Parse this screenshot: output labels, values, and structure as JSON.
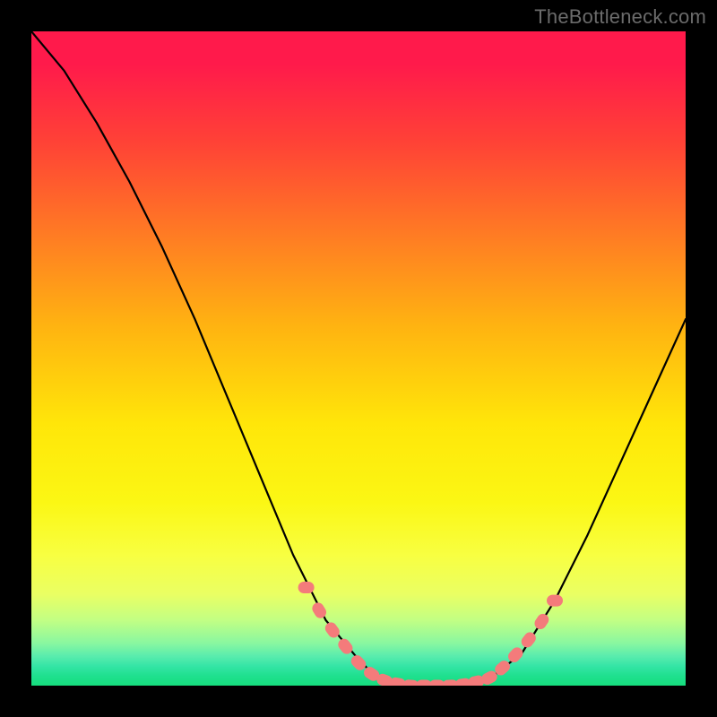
{
  "watermark": "TheBottleneck.com",
  "colors": {
    "frame": "#000000",
    "curve": "#000000",
    "dot_fill": "#f47b7b",
    "dot_stroke": "#e96a6a"
  },
  "chart_data": {
    "type": "line",
    "title": "",
    "xlabel": "",
    "ylabel": "",
    "xlim": [
      0,
      100
    ],
    "ylim": [
      0,
      100
    ],
    "grid": false,
    "legend": false,
    "series": [
      {
        "name": "bottleneck-curve",
        "x": [
          0,
          5,
          10,
          15,
          20,
          25,
          30,
          35,
          40,
          45,
          50,
          53,
          56,
          58,
          60,
          63,
          66,
          70,
          75,
          80,
          85,
          90,
          95,
          100
        ],
        "y": [
          100,
          94,
          86,
          77,
          67,
          56,
          44,
          32,
          20,
          10,
          4,
          1,
          0,
          0,
          0,
          0,
          0,
          1,
          5,
          13,
          23,
          34,
          45,
          56
        ]
      }
    ],
    "dots": [
      {
        "x": 42,
        "y": 15
      },
      {
        "x": 44,
        "y": 11.5
      },
      {
        "x": 46,
        "y": 8.5
      },
      {
        "x": 48,
        "y": 6
      },
      {
        "x": 50,
        "y": 3.5
      },
      {
        "x": 52,
        "y": 1.8
      },
      {
        "x": 54,
        "y": 0.8
      },
      {
        "x": 56,
        "y": 0.3
      },
      {
        "x": 58,
        "y": 0
      },
      {
        "x": 60,
        "y": 0
      },
      {
        "x": 62,
        "y": 0
      },
      {
        "x": 64,
        "y": 0
      },
      {
        "x": 66,
        "y": 0.2
      },
      {
        "x": 68,
        "y": 0.6
      },
      {
        "x": 70,
        "y": 1.2
      },
      {
        "x": 72,
        "y": 2.7
      },
      {
        "x": 74,
        "y": 4.7
      },
      {
        "x": 76,
        "y": 7
      },
      {
        "x": 78,
        "y": 9.8
      },
      {
        "x": 80,
        "y": 13
      }
    ]
  }
}
